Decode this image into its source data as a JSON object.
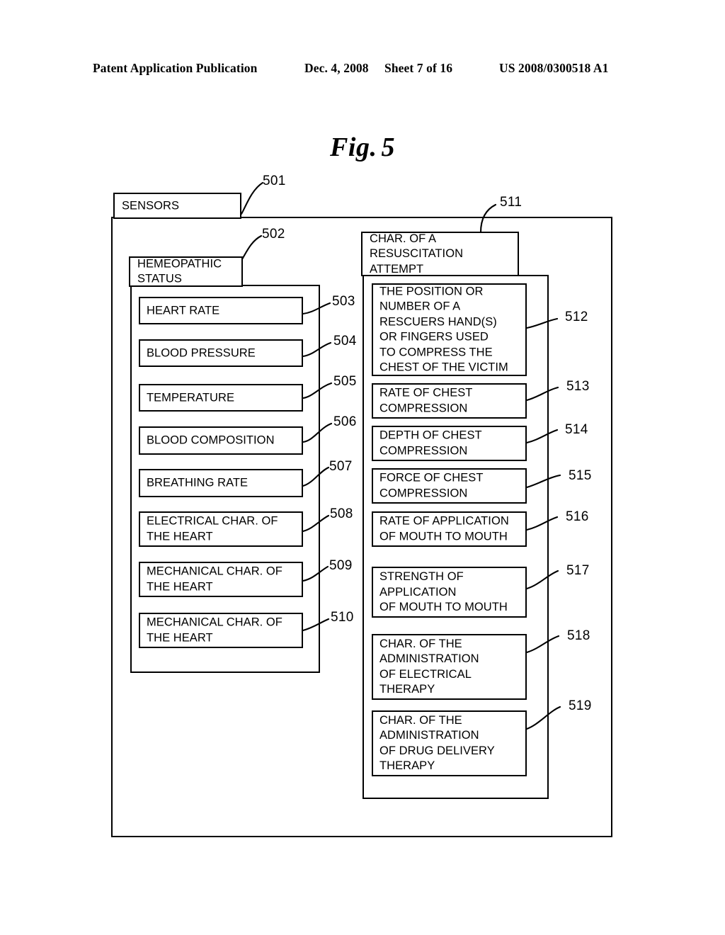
{
  "header": {
    "publication": "Patent Application Publication",
    "date": "Dec. 4, 2008",
    "sheet": "Sheet 7 of 16",
    "number": "US 2008/0300518 A1"
  },
  "figure": {
    "label": "Fig.",
    "number": "5"
  },
  "diagram": {
    "outer_tab": {
      "ref": "501",
      "label": "SENSORS"
    },
    "left_panel": {
      "tab": {
        "ref": "502",
        "label": "HEMEOPATHIC\nSTATUS"
      },
      "items": [
        {
          "ref": "503",
          "label": "HEART RATE"
        },
        {
          "ref": "504",
          "label": "BLOOD PRESSURE"
        },
        {
          "ref": "505",
          "label": "TEMPERATURE"
        },
        {
          "ref": "506",
          "label": "BLOOD COMPOSITION"
        },
        {
          "ref": "507",
          "label": "BREATHING RATE"
        },
        {
          "ref": "508",
          "label": "ELECTRICAL CHAR. OF\nTHE HEART"
        },
        {
          "ref": "509",
          "label": "MECHANICAL CHAR. OF\nTHE HEART"
        },
        {
          "ref": "510",
          "label": "MECHANICAL CHAR. OF\nTHE HEART"
        }
      ]
    },
    "right_panel": {
      "tab": {
        "ref": "511",
        "label": "CHAR. OF A\nRESUSCITATION\nATTEMPT"
      },
      "items": [
        {
          "ref": "512",
          "label": "THE POSITION OR\nNUMBER OF A\nRESCUERS HAND(S)\nOR FINGERS USED\nTO COMPRESS THE\nCHEST OF THE VICTIM"
        },
        {
          "ref": "513",
          "label": "RATE OF CHEST\nCOMPRESSION"
        },
        {
          "ref": "514",
          "label": "DEPTH OF CHEST\nCOMPRESSION"
        },
        {
          "ref": "515",
          "label": "FORCE OF CHEST\nCOMPRESSION"
        },
        {
          "ref": "516",
          "label": "RATE OF APPLICATION\nOF MOUTH TO MOUTH"
        },
        {
          "ref": "517",
          "label": "STRENGTH OF\nAPPLICATION\nOF MOUTH TO MOUTH"
        },
        {
          "ref": "518",
          "label": "CHAR. OF THE\nADMINISTRATION\nOF ELECTRICAL\nTHERAPY"
        },
        {
          "ref": "519",
          "label": "CHAR. OF THE\nADMINISTRATION\nOF DRUG DELIVERY\nTHERAPY"
        }
      ]
    }
  }
}
